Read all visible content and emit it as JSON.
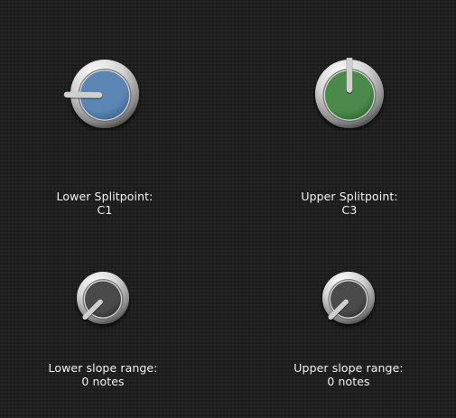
{
  "knobs": [
    {
      "id": "lower-splitpoint",
      "title": "Lower Splitpoint:",
      "value": "C1",
      "cap_color": "#5b86b3",
      "cap_color_dark": "#3d6690",
      "size": "large",
      "indicator_level": 0.17
    },
    {
      "id": "upper-splitpoint",
      "title": "Upper Splitpoint:",
      "value": "C3",
      "cap_color": "#4c8a4c",
      "cap_color_dark": "#2f6b30",
      "size": "large",
      "indicator_level": 0.5
    },
    {
      "id": "lower-slope-range",
      "title": "Lower slope range:",
      "value": "0 notes",
      "cap_color": "#4a4a4a",
      "cap_color_dark": "#333333",
      "size": "small",
      "indicator_level": 0.0
    },
    {
      "id": "upper-slope-range",
      "title": "Upper slope range:",
      "value": "0 notes",
      "cap_color": "#4a4a4a",
      "cap_color_dark": "#333333",
      "size": "small",
      "indicator_level": 0.0
    }
  ]
}
